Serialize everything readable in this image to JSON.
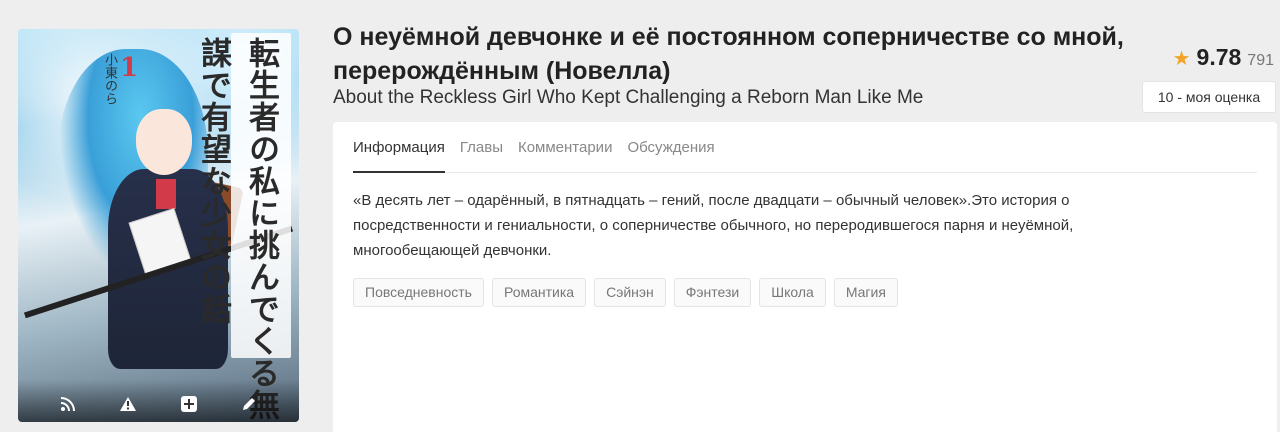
{
  "cover": {
    "title_jp": "転生者の私に挑んでくる無謀で有望な少女の話",
    "volume": "1",
    "author_jp": "小東のら",
    "actions": [
      {
        "name": "rss-icon",
        "glyph": "☉"
      },
      {
        "name": "warning-icon",
        "glyph": "⚠"
      },
      {
        "name": "add-icon",
        "glyph": "✚"
      },
      {
        "name": "edit-icon",
        "glyph": "✎"
      }
    ]
  },
  "title": {
    "ru": "О неуёмной девчонке и её постоянном соперничестве со мной, перерождённым (Новелла)",
    "en": "About the Reckless Girl Who Kept Challenging a Reborn Man Like Me"
  },
  "rating": {
    "star_icon": "star-icon",
    "score": "9.78",
    "count": "791",
    "my_rating": "10 - моя оценка",
    "star_color": "#f2a42a"
  },
  "tabs": [
    {
      "label": "Информация",
      "active": true
    },
    {
      "label": "Главы",
      "active": false
    },
    {
      "label": "Комментарии",
      "active": false
    },
    {
      "label": "Обсуждения",
      "active": false
    }
  ],
  "description": "«В десять лет – одарённый, в пятнадцать – гений, после двадцати – обычный человек».Это история о посредственности и гениальности, о соперничестве обычного, но переродившегося парня и неуёмной, многообещающей девчонки.",
  "tags": [
    "Повседневность",
    "Романтика",
    "Сэйнэн",
    "Фэнтези",
    "Школа",
    "Магия"
  ]
}
